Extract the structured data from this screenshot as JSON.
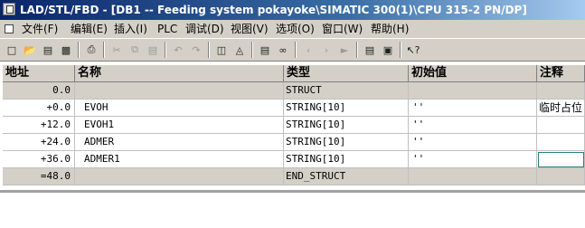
{
  "window": {
    "title": "LAD/STL/FBD  - [DB1 -- Feeding system pokayoke\\SIMATIC 300(1)\\CPU 315-2 PN/DP]"
  },
  "menu": {
    "items": [
      "文件(F)",
      "编辑(E)",
      "插入(I)",
      "PLC",
      "调试(D)",
      "视图(V)",
      "选项(O)",
      "窗口(W)",
      "帮助(H)"
    ]
  },
  "toolbar": {
    "icons": [
      "new-icon",
      "open-icon",
      "accessible-nodes-icon",
      "save-icon",
      "print-icon",
      "cut-icon",
      "copy-icon",
      "paste-icon",
      "undo-icon",
      "redo-icon",
      "download-icon",
      "upload-icon",
      "monitor-icon",
      "monitor-glasses-icon",
      "breakpoint-icon",
      "step-icon",
      "window-arrange-icon",
      "zoom-icon",
      "help-context-icon"
    ]
  },
  "table": {
    "headers": [
      "地址",
      "名称",
      "类型",
      "初始值",
      "注释"
    ],
    "rows": [
      {
        "address": "0.0",
        "name": "",
        "type": "STRUCT",
        "initial": "",
        "comment": "",
        "gray": true
      },
      {
        "address": "+0.0",
        "name": "EVOH",
        "type": "STRING[10]",
        "initial": "''",
        "comment": "临时占位",
        "gray": false
      },
      {
        "address": "+12.0",
        "name": "EVOH1",
        "type": "STRING[10]",
        "initial": "''",
        "comment": "",
        "gray": false
      },
      {
        "address": "+24.0",
        "name": "ADMER",
        "type": "STRING[10]",
        "initial": "''",
        "comment": "",
        "gray": false
      },
      {
        "address": "+36.0",
        "name": "ADMER1",
        "type": "STRING[10]",
        "initial": "''",
        "comment": "",
        "gray": false
      },
      {
        "address": "=48.0",
        "name": "",
        "type": "END_STRUCT",
        "initial": "",
        "comment": "",
        "gray": true
      }
    ]
  }
}
